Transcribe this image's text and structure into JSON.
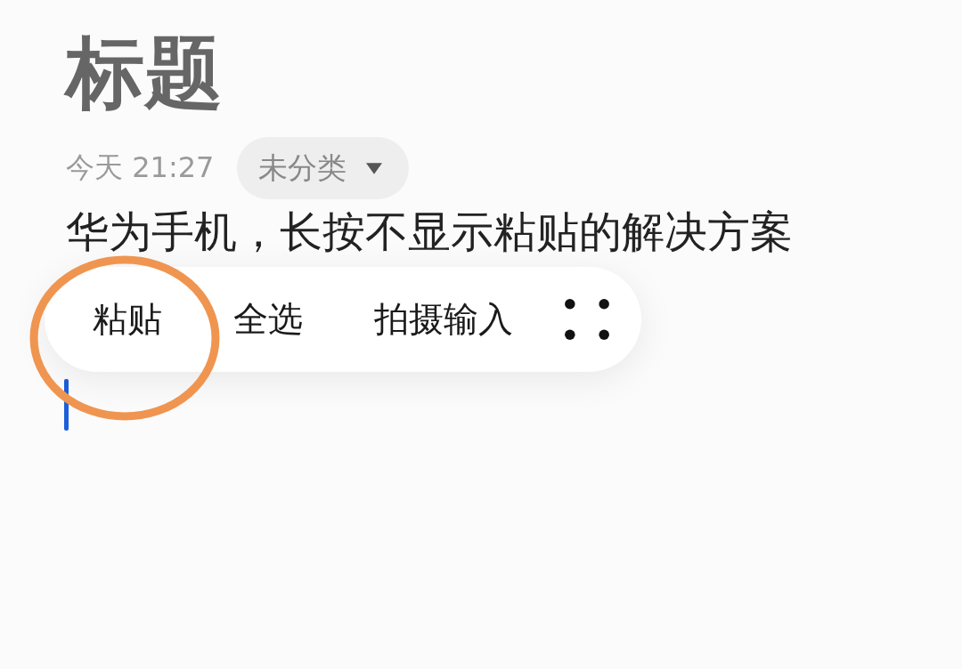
{
  "note": {
    "title": "标题",
    "date": "今天 21:27",
    "category": "未分类",
    "body": "华为手机，长按不显示粘贴的解决方案"
  },
  "context_menu": {
    "items": [
      {
        "label": "粘贴"
      },
      {
        "label": "全选"
      },
      {
        "label": "拍摄输入"
      }
    ]
  }
}
